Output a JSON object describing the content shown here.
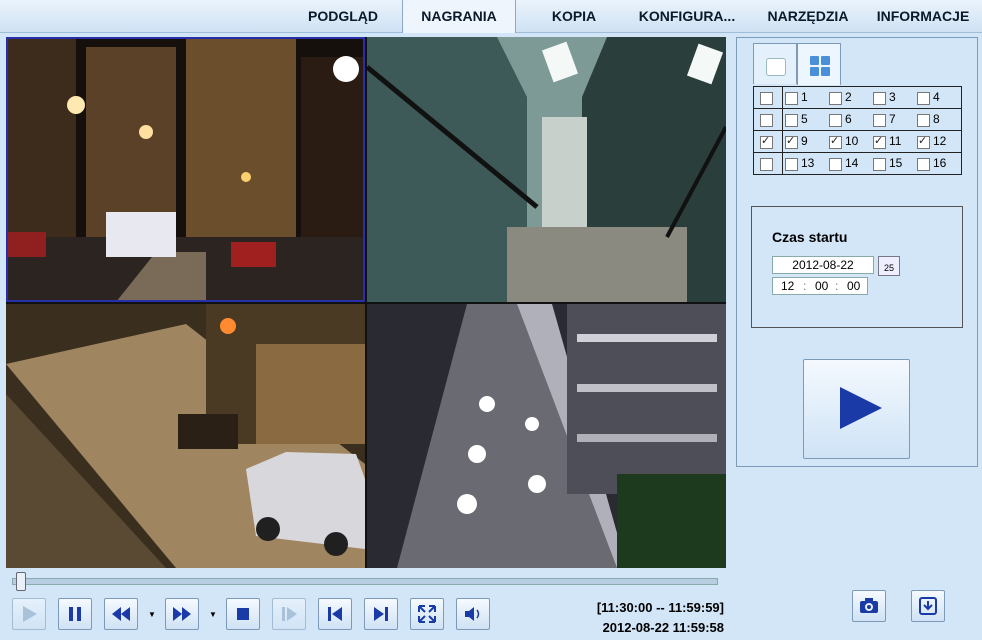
{
  "nav": {
    "tabs": [
      {
        "label": "PODGLĄD"
      },
      {
        "label": "NAGRANIA"
      },
      {
        "label": "KOPIA"
      },
      {
        "label": "KONFIGURA..."
      },
      {
        "label": "NARZĘDZIA"
      },
      {
        "label": "INFORMACJE"
      }
    ],
    "active": "NAGRANIA"
  },
  "channels": {
    "rows": [
      {
        "all": false,
        "items": [
          {
            "n": "1",
            "checked": false
          },
          {
            "n": "2",
            "checked": false
          },
          {
            "n": "3",
            "checked": false
          },
          {
            "n": "4",
            "checked": false
          }
        ]
      },
      {
        "all": false,
        "items": [
          {
            "n": "5",
            "checked": false
          },
          {
            "n": "6",
            "checked": false
          },
          {
            "n": "7",
            "checked": false
          },
          {
            "n": "8",
            "checked": false
          }
        ]
      },
      {
        "all": true,
        "items": [
          {
            "n": "9",
            "checked": true
          },
          {
            "n": "10",
            "checked": true
          },
          {
            "n": "11",
            "checked": true
          },
          {
            "n": "12",
            "checked": true
          }
        ]
      },
      {
        "all": false,
        "items": [
          {
            "n": "13",
            "checked": false
          },
          {
            "n": "14",
            "checked": false
          },
          {
            "n": "15",
            "checked": false
          },
          {
            "n": "16",
            "checked": false
          }
        ]
      }
    ]
  },
  "start": {
    "label": "Czas startu",
    "date": "2012-08-22",
    "calendar_day": "25",
    "time_h": "12",
    "time_m": "00",
    "time_s": "00",
    "sep": ":"
  },
  "status": {
    "range": "[11:30:00 -- 11:59:59]",
    "current": "2012-08-22 11:59:58"
  },
  "icons": {
    "layout_single": "single-view-icon",
    "layout_quad": "quad-view-icon",
    "play": "play-icon",
    "pause": "pause-icon",
    "rewind": "rewind-icon",
    "forward": "fast-forward-icon",
    "stop": "stop-icon",
    "step": "step-frame-icon",
    "prev": "previous-icon",
    "next": "next-icon",
    "fullscreen": "fullscreen-icon",
    "volume": "volume-icon",
    "snapshot": "camera-icon",
    "download": "download-icon"
  },
  "colors": {
    "accent": "#2840a8",
    "selection": "#2730a8"
  }
}
